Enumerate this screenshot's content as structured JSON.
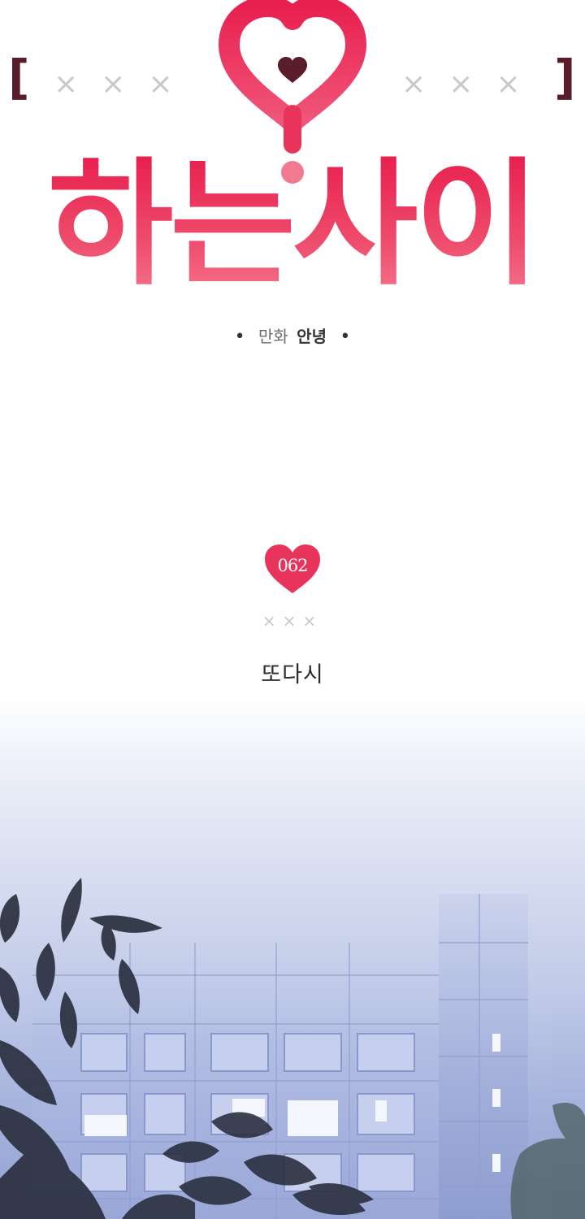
{
  "logo": {
    "bracket_left": "[",
    "bracket_right": "]",
    "xmarks_left": "×××",
    "xmarks_right": "×××",
    "title": "하는사이",
    "heart_color": "#e8335a",
    "inner_heart_color": "#5a1d2b"
  },
  "credit": {
    "bullet": "•",
    "role": "만화",
    "author": "안녕"
  },
  "episode": {
    "number": "062",
    "xmarks": "×××",
    "title": "또다시",
    "badge_color": "#e8335a"
  },
  "colors": {
    "accent": "#e8335a",
    "sky_top": "#ffffff",
    "sky_bottom": "#93a2d4",
    "building": "#a9b6de",
    "foliage": "#2a2f3f"
  }
}
